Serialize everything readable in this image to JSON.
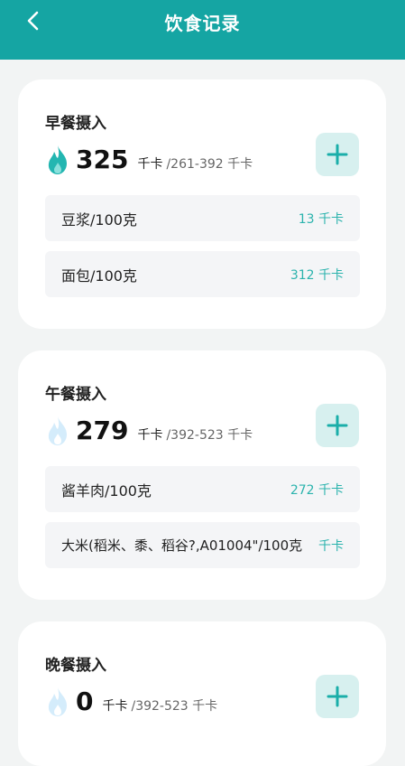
{
  "header": {
    "title": "饮食记录",
    "back_icon": "chevron-left-icon"
  },
  "colors": {
    "brand": "#15a5a3",
    "accent": "#2bb3ad",
    "flame_active": "#23b6b1",
    "flame_inactive": "#d4ecfb"
  },
  "meals": [
    {
      "title": "早餐摄入",
      "calories": "325",
      "unit": "千卡",
      "range": "/261-392 千卡",
      "flame_active": true,
      "items": [
        {
          "name": "豆浆/100克",
          "cal": "13 千卡"
        },
        {
          "name": "面包/100克",
          "cal": "312 千卡"
        }
      ]
    },
    {
      "title": "午餐摄入",
      "calories": "279",
      "unit": "千卡",
      "range": "/392-523 千卡",
      "flame_active": false,
      "items": [
        {
          "name": "酱羊肉/100克",
          "cal": "272 千卡"
        },
        {
          "name": "大米(稻米、黍、稻谷?,A01004\"/100克",
          "cal": "千卡"
        }
      ]
    },
    {
      "title": "晚餐摄入",
      "calories": "0",
      "unit": "千卡",
      "range": "/392-523 千卡",
      "flame_active": false,
      "items": []
    }
  ]
}
